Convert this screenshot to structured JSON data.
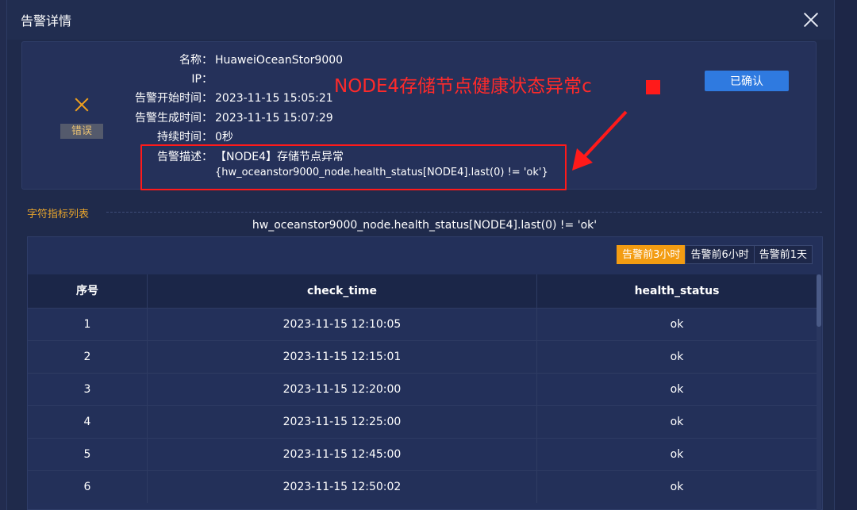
{
  "dialog": {
    "title": "告警详情"
  },
  "alarm": {
    "status_label": "错误",
    "fields": [
      {
        "label": "名称：",
        "value": "HuaweiOceanStor9000"
      },
      {
        "label": "IP：",
        "value": ""
      },
      {
        "label": "告警开始时间：",
        "value": "2023-11-15 15:05:21"
      },
      {
        "label": "告警生成时间：",
        "value": "2023-11-15 15:07:29"
      },
      {
        "label": "持续时间：",
        "value": "0秒"
      }
    ],
    "description_label": "告警描述：",
    "description_line1": "【NODE4】存储节点异常",
    "description_line2": "{hw_oceanstor9000_node.health_status[NODE4].last(0) != 'ok'}",
    "confirm_label": "已确认"
  },
  "annotation": {
    "text": "NODE4存储节点健康状态异常c",
    "color": "#ff1a1a"
  },
  "metrics": {
    "section_title": "字符指标列表",
    "expression": "hw_oceanstor9000_node.health_status[NODE4].last(0) != 'ok'",
    "range_tabs": [
      {
        "label": "告警前3小时",
        "active": true
      },
      {
        "label": "告警前6小时",
        "active": false
      },
      {
        "label": "告警前1天",
        "active": false
      }
    ],
    "columns": [
      "序号",
      "check_time",
      "health_status"
    ],
    "rows": [
      [
        "1",
        "2023-11-15 12:10:05",
        "ok"
      ],
      [
        "2",
        "2023-11-15 12:15:01",
        "ok"
      ],
      [
        "3",
        "2023-11-15 12:20:00",
        "ok"
      ],
      [
        "4",
        "2023-11-15 12:25:00",
        "ok"
      ],
      [
        "5",
        "2023-11-15 12:45:00",
        "ok"
      ],
      [
        "6",
        "2023-11-15 12:50:02",
        "ok"
      ]
    ]
  },
  "colors": {
    "accent": "#f39c12",
    "primary_button": "#2f7ae0",
    "background": "#1f2a4b"
  },
  "icons": {
    "close": "close-icon",
    "status": "error-x-icon"
  }
}
